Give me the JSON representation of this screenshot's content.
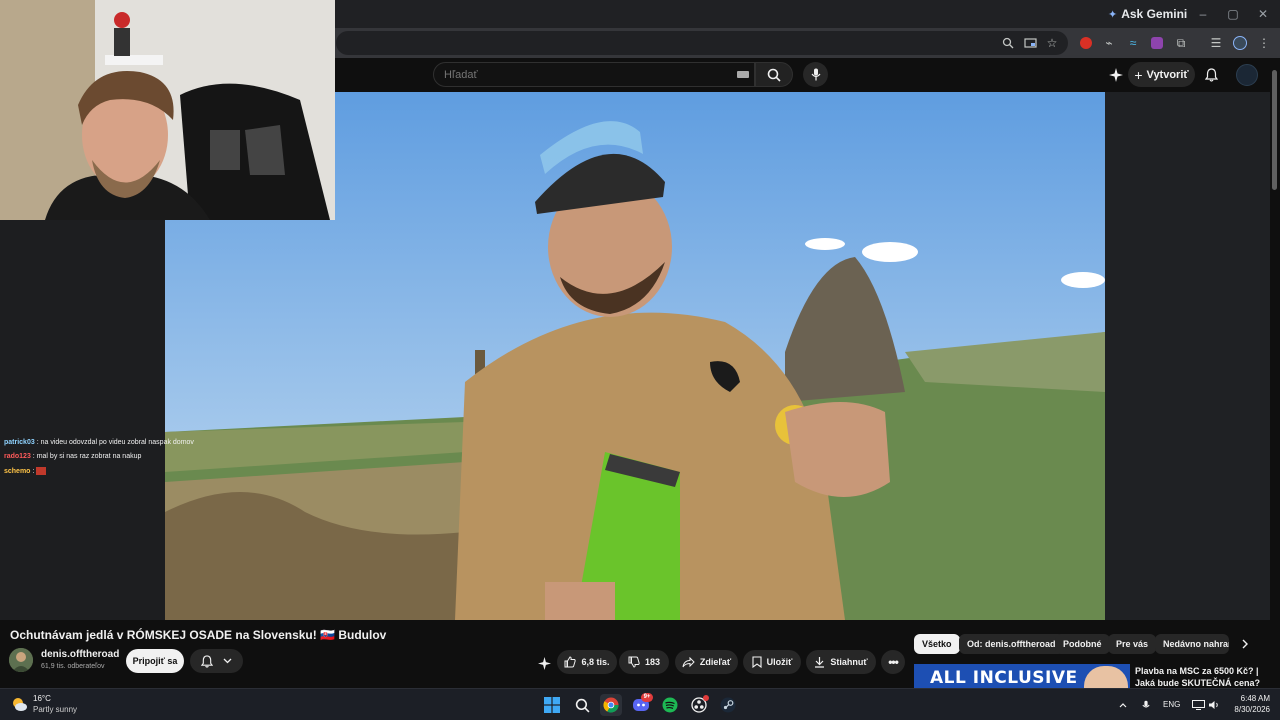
{
  "browser": {
    "ask_gemini": "Ask Gemini",
    "window_controls": [
      "–",
      "▢",
      "✕"
    ]
  },
  "youtube": {
    "search_placeholder": "Hľadať",
    "create_label": "Vytvoriť"
  },
  "chat": [
    {
      "user": "patrick03",
      "separator": " : ",
      "message": "na videu odovzdal po videu zobral naspak domov",
      "color": "#8fd3ff"
    },
    {
      "user": "rado123",
      "separator": " : ",
      "message": "mal by si nas raz zobrat na nakup",
      "color": "#ff5a5a"
    },
    {
      "user": "schemo",
      "separator": " : ",
      "message": "",
      "color": "#ffc447"
    }
  ],
  "video": {
    "title": "Ochutnávam jedlá v RÓMSKEJ OSADE na Slovensku! 🇸🇰 Budulov",
    "channel_name": "denis.offtheroad",
    "subscribers": "61,9 tis. odberateľov",
    "join_label": "Pripojiť sa",
    "likes": "6,8 tis.",
    "dislikes": "183",
    "share_label": "Zdieľať",
    "save_label": "Uložiť",
    "download_label": "Stiahnuť"
  },
  "chips": {
    "all": "Všetko",
    "from_channel": "Od: denis.offtheroad",
    "similar": "Podobné",
    "for_you": "Pre vás",
    "recently_uploaded": "Nedávno nahrané"
  },
  "recommendation": {
    "thumb_text": "ALL INCLUSIVE",
    "title": "Plavba na MSC za 6500 Kč? | Jaká bude SKUTEČNÁ cena? |"
  },
  "taskbar": {
    "temperature": "16°C",
    "weather": "Partly sunny",
    "language": "ENG",
    "time": "6:48 AM",
    "date": "8/30/2026",
    "discord_badge": "9+"
  },
  "colors": {
    "youtube_bg": "#0f0f0f",
    "chip_active": "#f1f1f1",
    "chrome_toolbar": "#35363a"
  }
}
